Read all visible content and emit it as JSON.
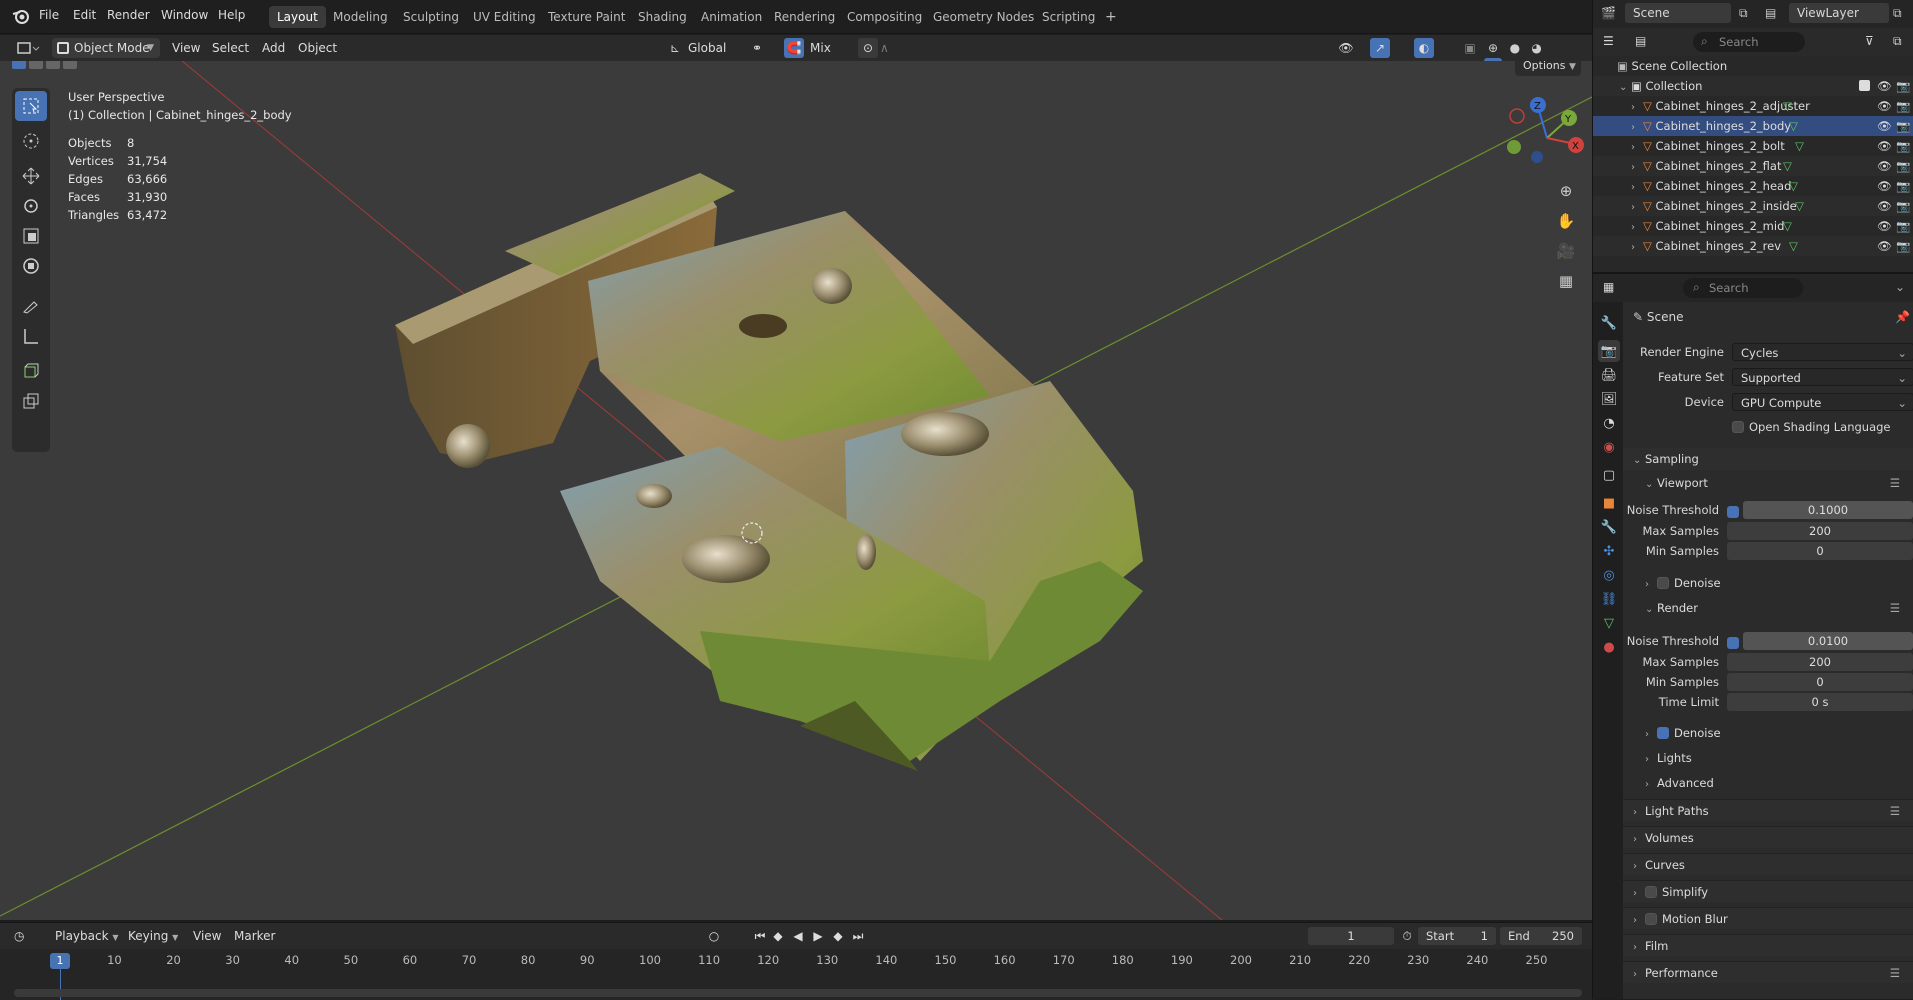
{
  "colors": {
    "accent": "#4772b3",
    "viewport_bg": "#3b3b3b",
    "axis_x": "#a33a3a",
    "axis_y": "#6c8f2f"
  },
  "topbar": {
    "menus": [
      "File",
      "Edit",
      "Render",
      "Window",
      "Help"
    ],
    "workspaces": [
      "Layout",
      "Modeling",
      "Sculpting",
      "UV Editing",
      "Texture Paint",
      "Shading",
      "Animation",
      "Rendering",
      "Compositing",
      "Geometry Nodes",
      "Scripting"
    ],
    "active_workspace": "Layout",
    "add_tab": "+",
    "scene": "Scene",
    "view_layer": "ViewLayer"
  },
  "viewport_header": {
    "mode": "Object Mode",
    "menus": [
      "View",
      "Select",
      "Add",
      "Object"
    ],
    "orientation": "Global",
    "snap_mode": "Mix",
    "options": "Options"
  },
  "viewport": {
    "perspective": "User Perspective",
    "collection_line": "(1) Collection | Cabinet_hinges_2_body",
    "stats": [
      {
        "label": "Objects",
        "value": "8"
      },
      {
        "label": "Vertices",
        "value": "31,754"
      },
      {
        "label": "Edges",
        "value": "63,666"
      },
      {
        "label": "Faces",
        "value": "31,930"
      },
      {
        "label": "Triangles",
        "value": "63,472"
      }
    ],
    "gizmo_labels": {
      "z": "Z",
      "y": "Y",
      "x": "X"
    }
  },
  "timeline": {
    "menus": [
      "Playback",
      "Keying",
      "View",
      "Marker"
    ],
    "current_frame": "1",
    "start_label": "Start",
    "start": "1",
    "end_label": "End",
    "end": "250",
    "ticks": [
      "1",
      "10",
      "20",
      "30",
      "40",
      "50",
      "60",
      "70",
      "80",
      "90",
      "100",
      "110",
      "120",
      "130",
      "140",
      "150",
      "160",
      "170",
      "180",
      "190",
      "200",
      "210",
      "220",
      "230",
      "240",
      "250"
    ]
  },
  "outliner": {
    "search_placeholder": "Search",
    "scene_collection": "Scene Collection",
    "collection": "Collection",
    "objects": [
      "Cabinet_hinges_2_adjuster",
      "Cabinet_hinges_2_body",
      "Cabinet_hinges_2_bolt",
      "Cabinet_hinges_2_flat",
      "Cabinet_hinges_2_head",
      "Cabinet_hinges_2_inside",
      "Cabinet_hinges_2_mid",
      "Cabinet_hinges_2_rev"
    ],
    "selected": "Cabinet_hinges_2_body"
  },
  "properties": {
    "search_placeholder": "Search",
    "context": "Scene",
    "render_engine_label": "Render Engine",
    "render_engine": "Cycles",
    "feature_set_label": "Feature Set",
    "feature_set": "Supported",
    "device_label": "Device",
    "device": "GPU Compute",
    "osl_label": "Open Shading Language",
    "sampling": "Sampling",
    "viewport": "Viewport",
    "noise_threshold_label": "Noise Threshold",
    "max_samples_label": "Max Samples",
    "min_samples_label": "Min Samples",
    "viewport_noise_threshold": "0.1000",
    "viewport_max_samples": "200",
    "viewport_min_samples": "0",
    "denoise_label": "Denoise",
    "render": "Render",
    "render_noise_threshold": "0.0100",
    "render_max_samples": "200",
    "render_min_samples": "0",
    "time_limit_label": "Time Limit",
    "time_limit": "0 s",
    "lights": "Lights",
    "advanced": "Advanced",
    "light_paths": "Light Paths",
    "volumes": "Volumes",
    "curves": "Curves",
    "simplify": "Simplify",
    "motion_blur": "Motion Blur",
    "film": "Film",
    "performance": "Performance"
  }
}
